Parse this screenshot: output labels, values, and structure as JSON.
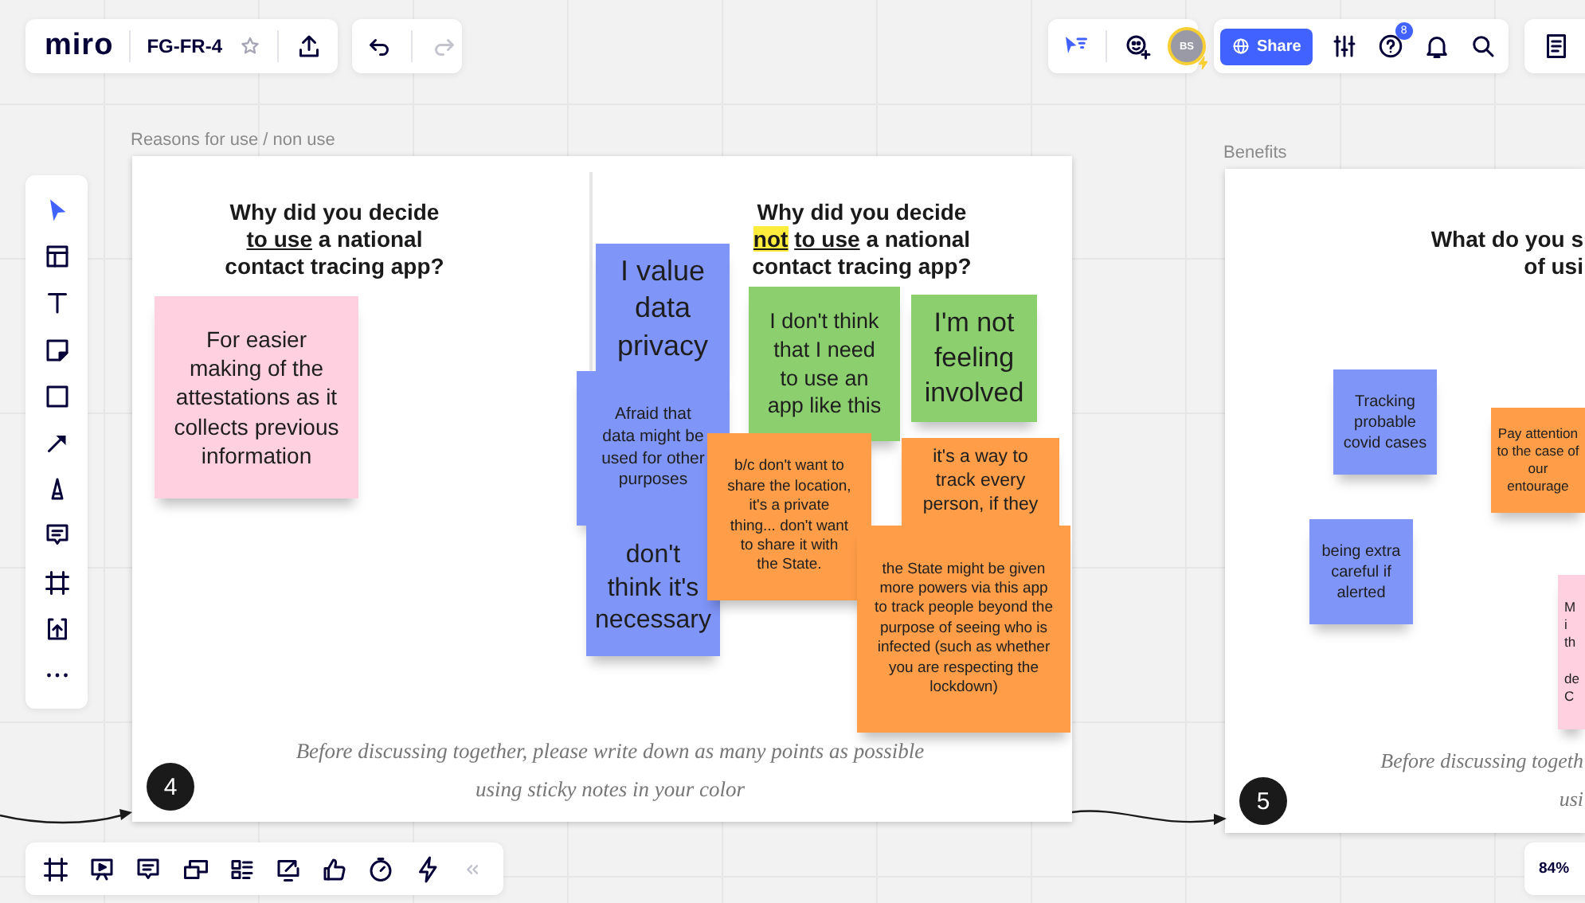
{
  "top_bar": {
    "logo": "miro",
    "board_name": "FG-FR-4",
    "avatar_initials": "BS",
    "share_button": "Share",
    "help_badge": "8"
  },
  "left_toolbar": {
    "tools": [
      {
        "selected": true
      },
      {
        "selected": false
      },
      {
        "selected": false
      },
      {
        "selected": false
      },
      {
        "selected": false
      },
      {
        "selected": false
      },
      {
        "selected": false
      },
      {
        "selected": false
      },
      {
        "selected": false
      },
      {
        "selected": false
      },
      {
        "selected": false
      }
    ]
  },
  "frames": [
    {
      "label": "Reasons for use / non use",
      "number": "4",
      "questions": [
        {
          "lines": [
            [
              {
                "text": "Why did you decide"
              }
            ],
            [
              {
                "text": "to use",
                "underline": true
              },
              {
                "text": "a national"
              }
            ],
            [
              {
                "text": "contact tracing app?"
              }
            ]
          ]
        },
        {
          "lines": [
            [
              {
                "text": "Why did you decide"
              }
            ],
            [
              {
                "text": "not",
                "underline": true,
                "highlight": true
              },
              {
                "text": "to use",
                "underline": true
              },
              {
                "text": "a national"
              }
            ],
            [
              {
                "text": "contact tracing app?"
              }
            ]
          ]
        }
      ],
      "notes": [
        {
          "text": "For easier\nmaking of the\nattestations as it\ncollects previous\ninformation",
          "color": "#ffd0e0"
        },
        {
          "text": "I value\ndata\nprivacy",
          "color": "#7f95f8"
        },
        {
          "text": "Afraid that\ndata might be\nused for other\npurposes",
          "color": "#7f95f8"
        },
        {
          "text": "don't\nthink it's\nnecessary",
          "color": "#7f95f8"
        },
        {
          "text": "I don't think\nthat I need\nto use an\napp like this",
          "color": "#8ccf6e"
        },
        {
          "text": "I'm not\nfeeling\ninvolved",
          "color": "#8ccf6e"
        },
        {
          "text": "b/c don't want to\nshare the location,\nit's a private\nthing... don't want\nto share it with\nthe State.",
          "color": "#ff9d48"
        },
        {
          "text": "it's a way to\ntrack every\nperson, if they",
          "color": "#ff9d48"
        },
        {
          "text": "the State might be given\nmore powers via this app\nto track people beyond the\npurpose of seeing who is\ninfected (such as whether\nyou are respecting the\nlockdown)",
          "color": "#ff9d48"
        }
      ],
      "footer": "Before discussing together, please write down as many points as possible\nusing sticky notes in your color"
    },
    {
      "label": "Benefits",
      "number": "5",
      "questions": [
        {
          "lines": [
            [
              {
                "text": "What do you s"
              }
            ],
            [
              {
                "text": "of usi"
              }
            ]
          ]
        }
      ],
      "notes": [
        {
          "text": "Tracking\nprobable\ncovid cases",
          "color": "#7f95f8"
        },
        {
          "text": "being extra\ncareful if\nalerted",
          "color": "#7f95f8"
        },
        {
          "text": "Pay attention\nto the case of\nour\nentourage",
          "color": "#ff9d48"
        },
        {
          "text": "M\ni\nth\n\nde\nC",
          "color": "#ffd0e0"
        }
      ],
      "footer": "Before discussing togeth\nusi"
    }
  ],
  "zoom_level": "84%"
}
